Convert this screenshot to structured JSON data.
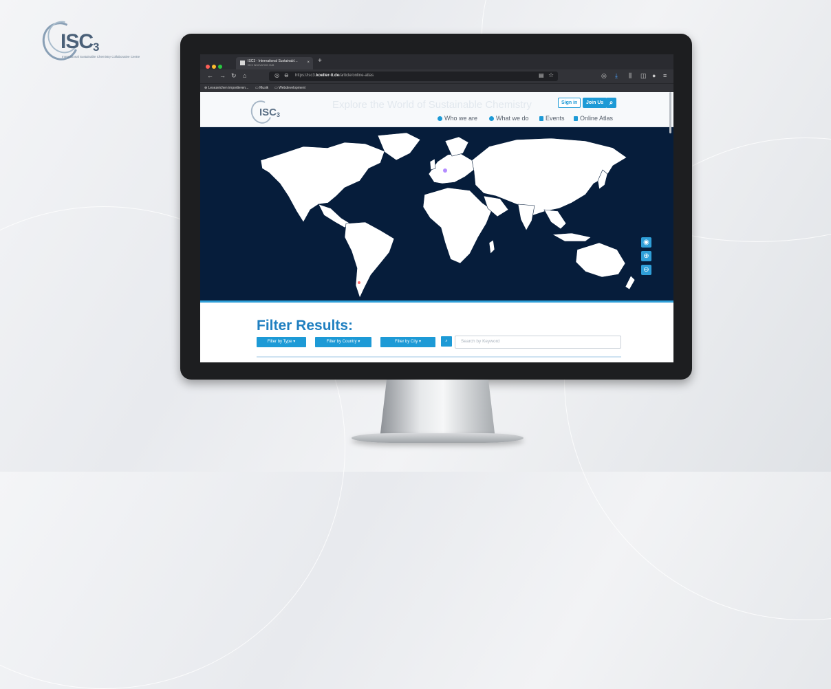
{
  "brand": {
    "word": "ISC",
    "sub": "3",
    "tagline": "International Sustainable Chemistry Collaborative Centre"
  },
  "browser": {
    "tab_title": "ISC3 - International Sustainabl…",
    "tab_subtitle": "ISC3 INNOVATION HUB",
    "url_prefix": "https://isc3.",
    "url_domain": "koeller-it.de",
    "url_path": "/article/online-atlas",
    "bookmarks": [
      "Lesezeichen importieren...",
      "Musik",
      "Webdevelopment"
    ]
  },
  "site": {
    "logo_word": "ISC",
    "logo_sub": "3",
    "hero_text": "Explore the World of Sustainable Chemistry",
    "signin_label": "Sign in",
    "join_label": "Join Us",
    "nav": [
      "Who we are",
      "What we do",
      "Events",
      "Online Atlas"
    ],
    "filter_title": "Filter Results:",
    "filter_type": "Filter by Type ▾",
    "filter_country": "Filter by Country ▾",
    "filter_city": "Filter by City ▾",
    "search_placeholder": "Search by Keyword"
  },
  "icons": {
    "search": "search-icon",
    "globe": "globe-icon",
    "zoom_in": "zoom-in-icon",
    "zoom_out": "zoom-out-icon"
  },
  "colors": {
    "accent": "#1d9ad6",
    "map_ocean": "#061d3b",
    "land": "#ffffff"
  }
}
